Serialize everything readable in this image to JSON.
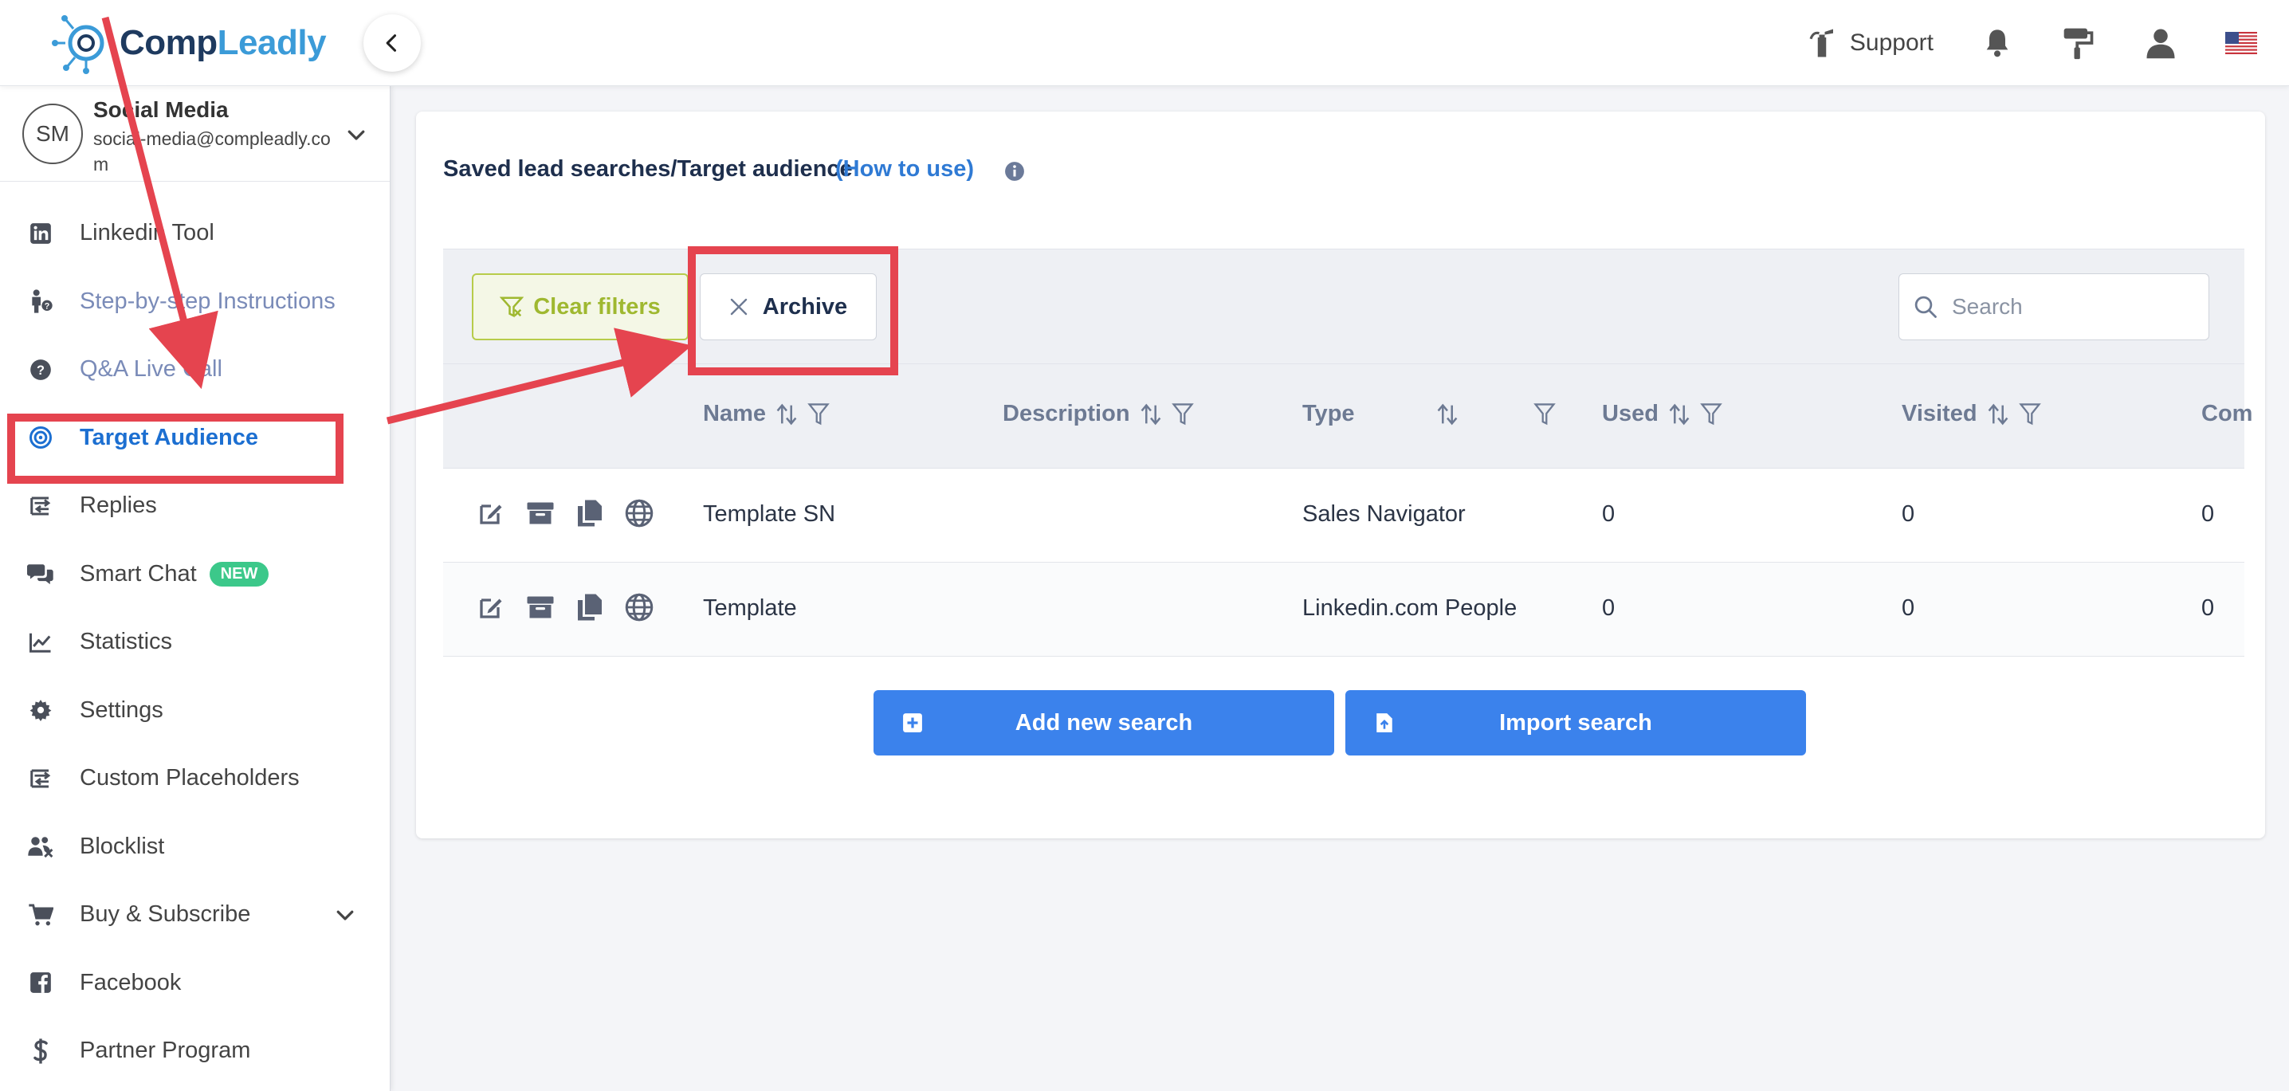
{
  "brand": {
    "name_part1": "Comp",
    "name_part2": "Leadly",
    "logo_icon": "network-logo-icon"
  },
  "header": {
    "support_label": "Support",
    "icons": [
      "fire-extinguisher-icon",
      "bell-icon",
      "paint-roller-icon",
      "user-icon",
      "us-flag-icon"
    ]
  },
  "account": {
    "initials": "SM",
    "name": "Social Media",
    "email": "social-media@compleadly.com"
  },
  "sidebar": {
    "items": [
      {
        "label": "Linkedin Tool",
        "icon": "linkedin-icon"
      },
      {
        "label": "Step-by-step Instructions",
        "icon": "instructions-icon"
      },
      {
        "label": "Q&A Live Call",
        "icon": "question-circle-icon"
      },
      {
        "label": "Target Audience",
        "icon": "target-icon",
        "active": true
      },
      {
        "label": "Replies",
        "icon": "replies-icon"
      },
      {
        "label": "Smart Chat",
        "icon": "chat-bubbles-icon",
        "badge": "NEW"
      },
      {
        "label": "Statistics",
        "icon": "line-chart-icon"
      },
      {
        "label": "Settings",
        "icon": "gear-icon"
      },
      {
        "label": "Custom Placeholders",
        "icon": "placeholders-icon"
      },
      {
        "label": "Blocklist",
        "icon": "users-block-icon"
      },
      {
        "label": "Buy & Subscribe",
        "icon": "cart-icon",
        "expandable": true
      },
      {
        "label": "Facebook",
        "icon": "facebook-icon"
      },
      {
        "label": "Partner Program",
        "icon": "dollar-icon"
      }
    ]
  },
  "main": {
    "title": "Saved lead searches/Target audience",
    "how_to_label": "(How to use)",
    "toolbar": {
      "clear_filters_label": "Clear filters",
      "archive_label": "Archive",
      "search_placeholder": "Search"
    },
    "table": {
      "columns": [
        "Name",
        "Description",
        "Type",
        "Used",
        "Visited",
        "Com"
      ],
      "rows": [
        {
          "name": "Template SN",
          "description": "",
          "type": "Sales Navigator",
          "used": "0",
          "visited": "0",
          "com": "0"
        },
        {
          "name": "Template",
          "description": "",
          "type": "Linkedin.com People",
          "used": "0",
          "visited": "0",
          "com": "0"
        }
      ],
      "row_actions": [
        "edit-icon",
        "archive-box-icon",
        "copy-icon",
        "globe-icon"
      ]
    },
    "add_new_search_label": "Add new search",
    "import_search_label": "Import search"
  },
  "colors": {
    "accent_blue": "#3b82ec",
    "active_nav": "#1c6fd1",
    "clear_filters_green": "#9fb830",
    "badge_green": "#3cc88a",
    "annotation_red": "#e5444f"
  }
}
